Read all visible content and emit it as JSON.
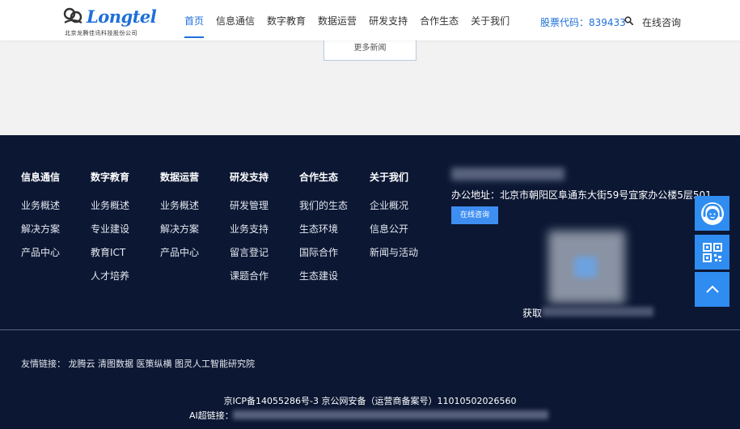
{
  "header": {
    "logo_word": "Longtel",
    "logo_sub": "北京龙腾佳讯科技股份公司",
    "nav": [
      "首页",
      "信息通信",
      "数字教育",
      "数据运营",
      "研发支持",
      "合作生态",
      "关于我们"
    ],
    "stock": "股票代码：839433",
    "consult": "在线咨询"
  },
  "main": {
    "more_news": "更多新闻"
  },
  "footer": {
    "columns": [
      {
        "title": "信息通信",
        "links": [
          "业务概述",
          "解决方案",
          "产品中心"
        ]
      },
      {
        "title": "数字教育",
        "links": [
          "业务概述",
          "专业建设",
          "教育ICT",
          "人才培养"
        ]
      },
      {
        "title": "数据运营",
        "links": [
          "业务概述",
          "解决方案",
          "产品中心"
        ]
      },
      {
        "title": "研发支持",
        "links": [
          "研发管理",
          "业务支持",
          "留言登记",
          "课题合作"
        ]
      },
      {
        "title": "合作生态",
        "links": [
          "我们的生态",
          "生态环境",
          "国际合作",
          "生态建设"
        ]
      },
      {
        "title": "关于我们",
        "links": [
          "企业概况",
          "信息公开",
          "新闻与活动"
        ]
      }
    ],
    "address": "办公地址：北京市朝阳区阜通东大街59号宜家办公楼5层501",
    "online_btn": "在线咨询",
    "get_text": "获取",
    "friend_links": "友情链接：  龙腾云  清图数据  医策纵横  图灵人工智能研究院",
    "icp": "京ICP备14055286号-3 京公网安备（运营商备案号）11010502026560",
    "ai_label": "AI超链接："
  },
  "colors": {
    "brand_blue": "#1e6fd9",
    "footer_bg": "#0b1733",
    "float_blue": "#2f8cf0"
  },
  "icons": [
    "search-icon",
    "customer-service-icon",
    "qr-code-icon",
    "arrow-up-icon"
  ]
}
